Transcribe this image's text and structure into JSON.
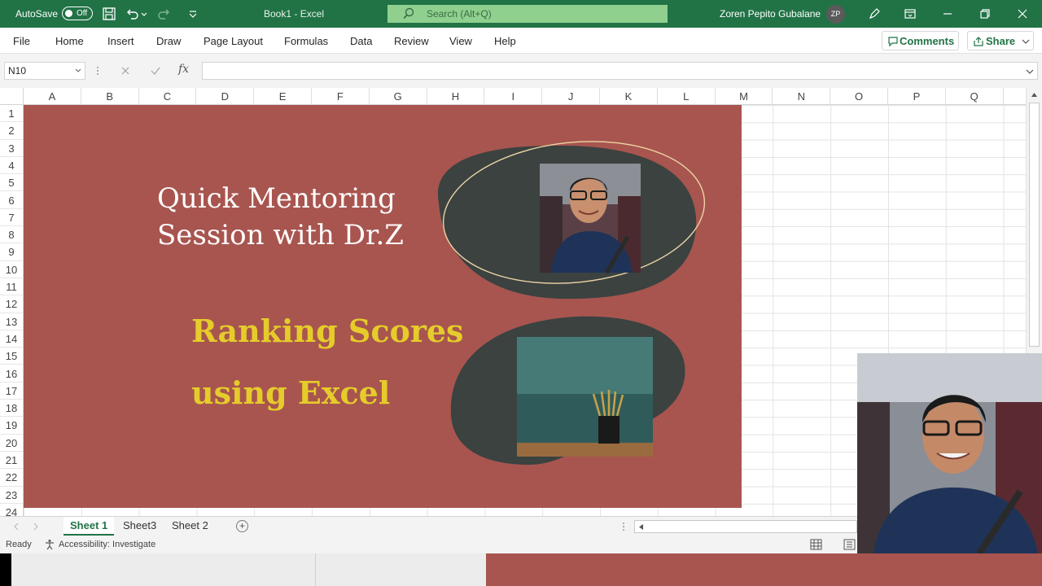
{
  "titlebar": {
    "autosave_label": "AutoSave",
    "autosave_state": "Off",
    "document_title": "Book1  -  Excel",
    "search_placeholder": "Search (Alt+Q)",
    "user_name": "Zoren Pepito Gubalane",
    "user_initials": "ZP"
  },
  "menu": {
    "file": "File",
    "home": "Home",
    "insert": "Insert",
    "draw": "Draw",
    "page_layout": "Page Layout",
    "formulas": "Formulas",
    "data": "Data",
    "review": "Review",
    "view": "View",
    "help": "Help",
    "comments": "Comments",
    "share": "Share"
  },
  "formula_bar": {
    "name_box": "N10",
    "fx": "fx",
    "formula": ""
  },
  "grid": {
    "columns": [
      "A",
      "B",
      "C",
      "D",
      "E",
      "F",
      "G",
      "H",
      "I",
      "J",
      "K",
      "L",
      "M",
      "N",
      "O",
      "P",
      "Q"
    ],
    "rows": [
      "1",
      "2",
      "3",
      "4",
      "5",
      "6",
      "7",
      "8",
      "9",
      "10",
      "11",
      "12",
      "13",
      "14",
      "15",
      "16",
      "17",
      "18",
      "19",
      "20",
      "21",
      "22",
      "23",
      "24"
    ]
  },
  "slide": {
    "title": "Quick Mentoring\nSession with Dr.Z",
    "subtitle": "Ranking Scores\nusing Excel",
    "background_color": "#a8554f",
    "title_color": "#ffffff",
    "subtitle_color": "#e5cc2a",
    "blob_color": "#3b4240"
  },
  "sheets": {
    "tabs": [
      "Sheet 1",
      "Sheet3",
      "Sheet 2"
    ],
    "active": "Sheet 1"
  },
  "status": {
    "ready": "Ready",
    "accessibility": "Accessibility: Investigate"
  },
  "colors": {
    "excel_green": "#217346",
    "search_bg": "#8fd08f"
  }
}
